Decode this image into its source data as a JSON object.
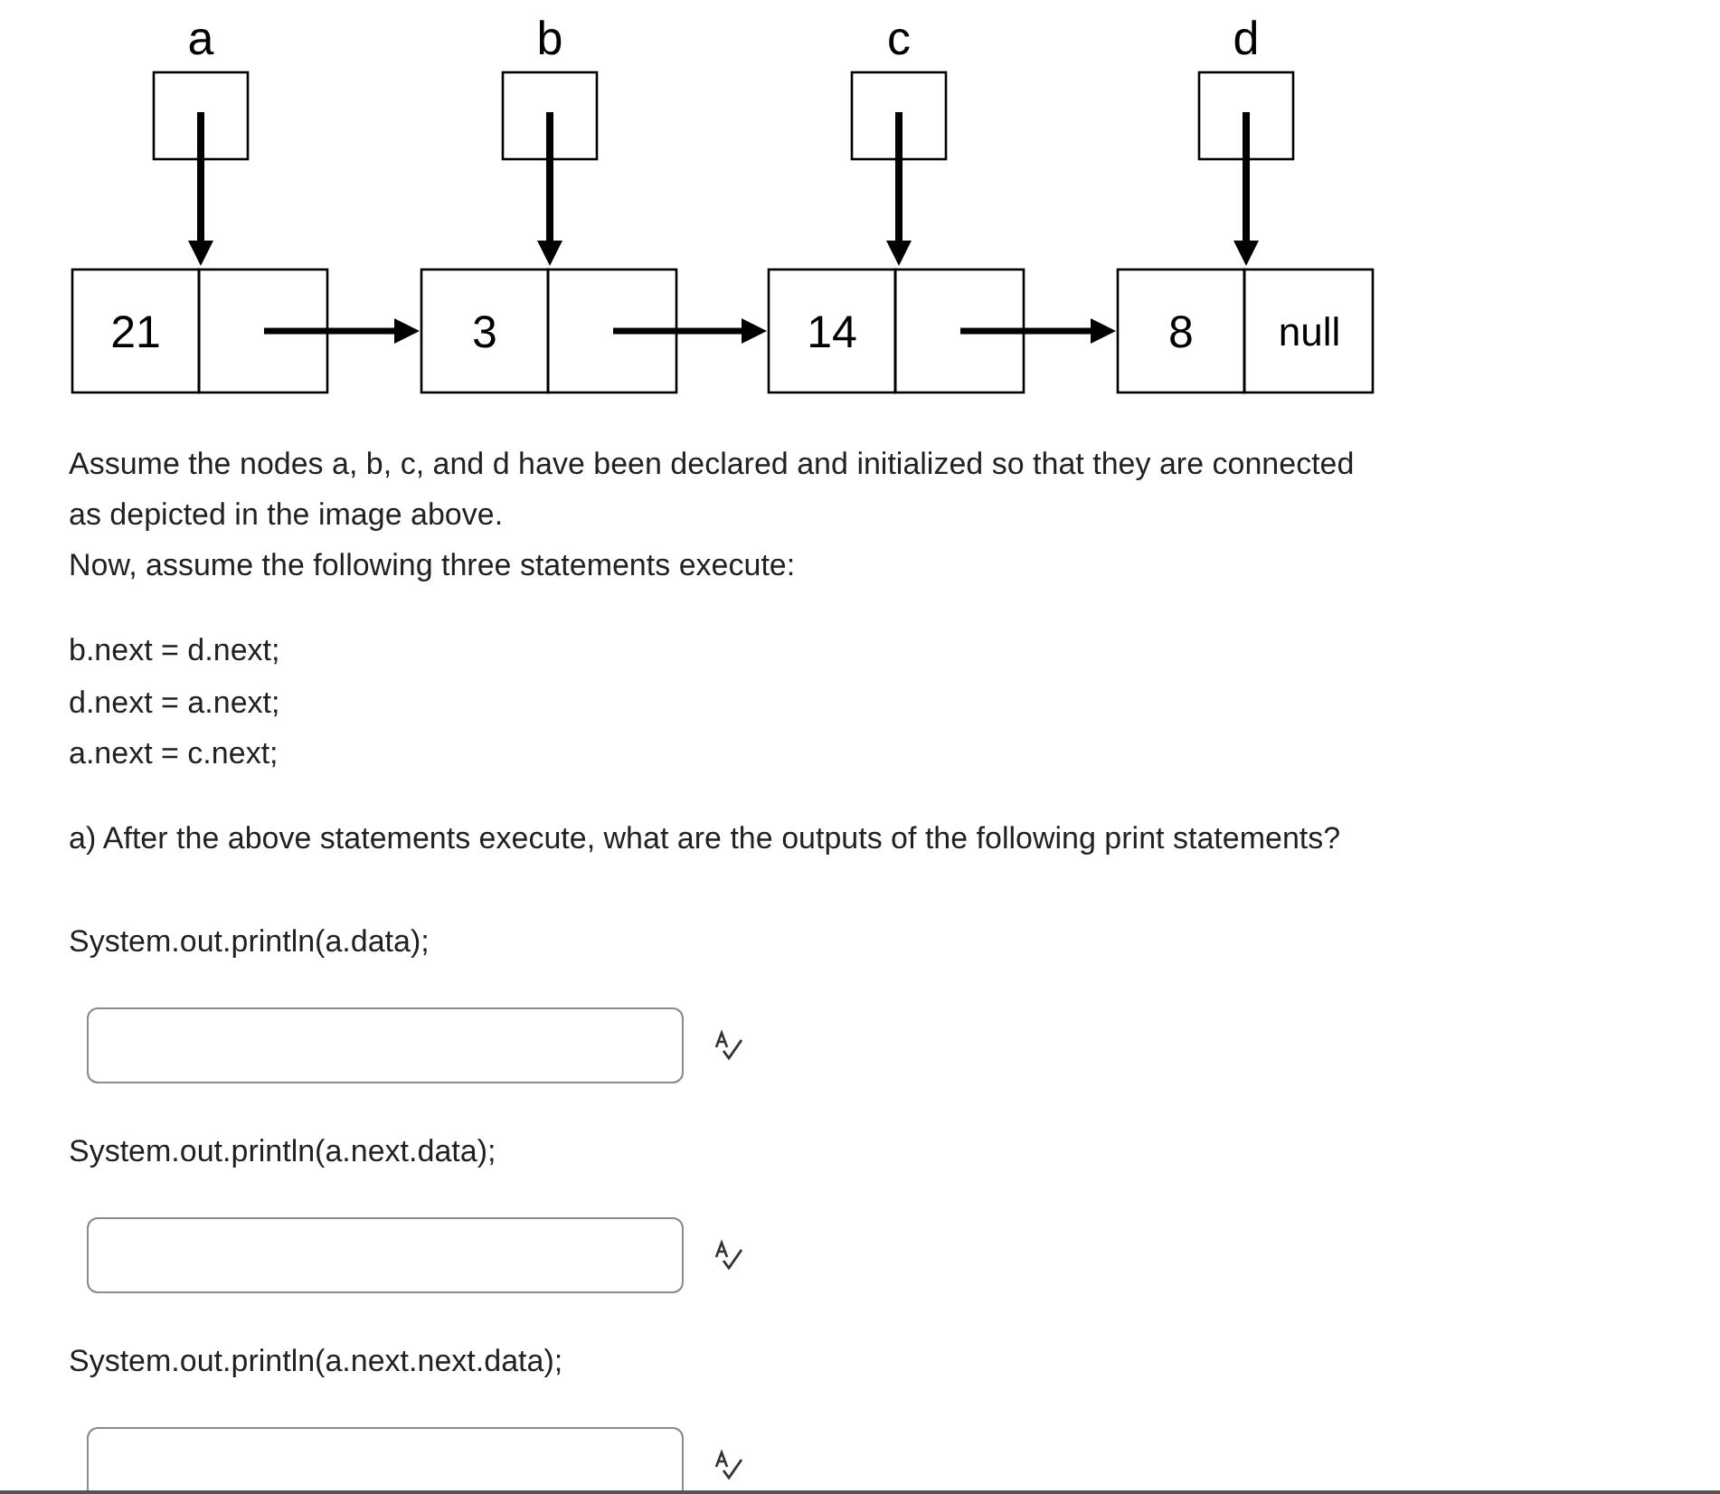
{
  "diagram": {
    "pointers": [
      {
        "label": "a"
      },
      {
        "label": "b"
      },
      {
        "label": "c"
      },
      {
        "label": "d"
      }
    ],
    "nodes": [
      {
        "value": "21"
      },
      {
        "value": "3"
      },
      {
        "value": "14"
      },
      {
        "value": "8",
        "next": "null"
      }
    ]
  },
  "intro": [
    "Assume the nodes a, b, c, and d have been declared and initialized so that they are connected as depicted in the image above.",
    "Now, assume the following three statements execute:"
  ],
  "code_lines": [
    "b.next = d.next;",
    "d.next = a.next;",
    "a.next = c.next;"
  ],
  "question": "a) After the above statements execute, what are the outputs of the following print statements?",
  "answers": [
    {
      "prompt": "System.out.println(a.data);"
    },
    {
      "prompt": "System.out.println(a.next.data);"
    },
    {
      "prompt": "System.out.println(a.next.next.data);"
    }
  ]
}
